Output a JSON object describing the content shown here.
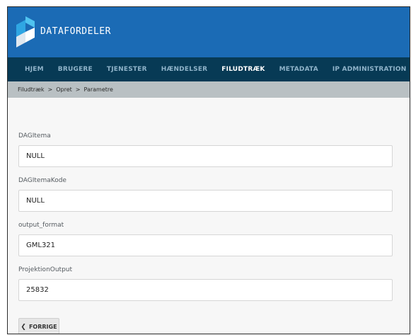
{
  "header": {
    "brand": "DATAFORDELER"
  },
  "nav": {
    "items": [
      {
        "label": "HJEM",
        "active": false
      },
      {
        "label": "BRUGERE",
        "active": false
      },
      {
        "label": "TJENESTER",
        "active": false
      },
      {
        "label": "HÆNDELSER",
        "active": false
      },
      {
        "label": "FILUDTRÆK",
        "active": true
      },
      {
        "label": "METADATA",
        "active": false
      },
      {
        "label": "IP ADMINISTRATION",
        "active": false
      }
    ]
  },
  "breadcrumb": {
    "items": [
      "Filudtræk",
      "Opret",
      "Parametre"
    ],
    "separator": ">"
  },
  "form": {
    "fields": [
      {
        "label": "DAGItema",
        "value": "NULL"
      },
      {
        "label": "DAGItemaKode",
        "value": "NULL"
      },
      {
        "label": "output_format",
        "value": "GML321"
      },
      {
        "label": "ProjektionOutput",
        "value": "25832"
      }
    ],
    "back_label": "FORRIGE"
  },
  "colors": {
    "header": "#1b6bb5",
    "nav": "#073a55",
    "breadcrumb": "#b9c0c3"
  },
  "icons": {
    "logo": "datafordeler-logo-icon",
    "back": "chevron-left-icon"
  }
}
